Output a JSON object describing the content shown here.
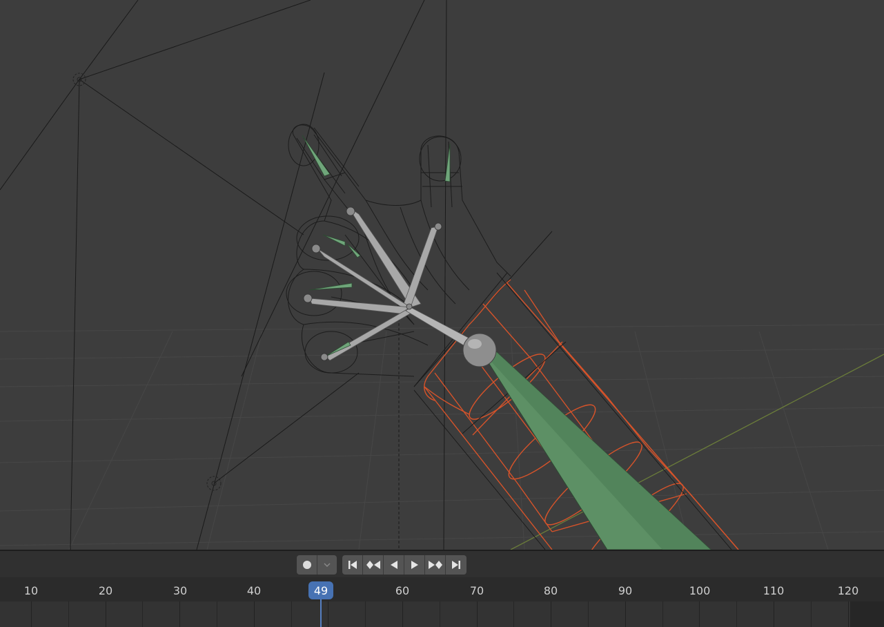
{
  "viewport": {
    "name": "3D Viewport - armature hand rig wireframe"
  },
  "playback": {
    "record_icon": "record-circle-icon",
    "dropdown_icon": "chevron-down-icon",
    "buttons": [
      {
        "name": "jump-to-start-button",
        "icon": "jump-start-icon"
      },
      {
        "name": "previous-keyframe-button",
        "icon": "prev-keyframe-icon"
      },
      {
        "name": "play-reverse-button",
        "icon": "play-reverse-icon"
      },
      {
        "name": "play-button",
        "icon": "play-icon"
      },
      {
        "name": "next-keyframe-button",
        "icon": "next-keyframe-icon"
      },
      {
        "name": "jump-to-end-button",
        "icon": "jump-end-icon"
      }
    ]
  },
  "timeline": {
    "ticks": [
      "10",
      "20",
      "30",
      "40",
      "60",
      "70",
      "80",
      "90",
      "100",
      "110",
      "120"
    ],
    "current_frame": "49",
    "accent_color": "#4772b3"
  }
}
